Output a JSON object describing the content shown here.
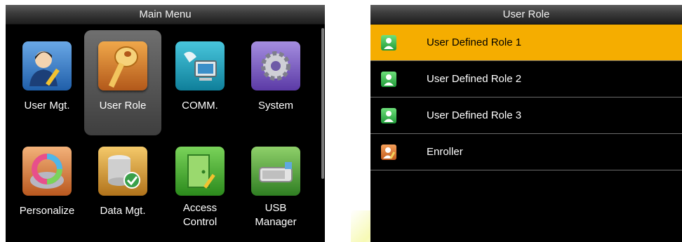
{
  "main_menu": {
    "title": "Main Menu",
    "items": [
      {
        "label": "User Mgt.",
        "icon": "user-management-icon"
      },
      {
        "label": "User Role",
        "icon": "key-icon",
        "selected": true
      },
      {
        "label": "COMM.",
        "icon": "communication-icon"
      },
      {
        "label": "System",
        "icon": "gear-icon"
      },
      {
        "label": "Personalize",
        "icon": "color-wheel-icon"
      },
      {
        "label": "Data Mgt.",
        "icon": "database-check-icon"
      },
      {
        "label": "Access Control",
        "label_line1": "Access",
        "label_line2": "Control",
        "icon": "door-icon"
      },
      {
        "label": "USB Manager",
        "label_line1": "USB",
        "label_line2": "Manager",
        "icon": "usb-drive-icon"
      }
    ]
  },
  "user_role": {
    "title": "User Role",
    "items": [
      {
        "label": "User Defined Role 1",
        "icon": "user-role-icon",
        "selected": true
      },
      {
        "label": "User Defined Role 2",
        "icon": "user-role-icon"
      },
      {
        "label": "User Defined Role 3",
        "icon": "user-role-icon"
      },
      {
        "label": "Enroller",
        "icon": "enroller-icon"
      }
    ]
  },
  "colors": {
    "highlight": "#f5ad00",
    "screen_bg": "#000000",
    "titlebar": "#3a3a3a"
  }
}
